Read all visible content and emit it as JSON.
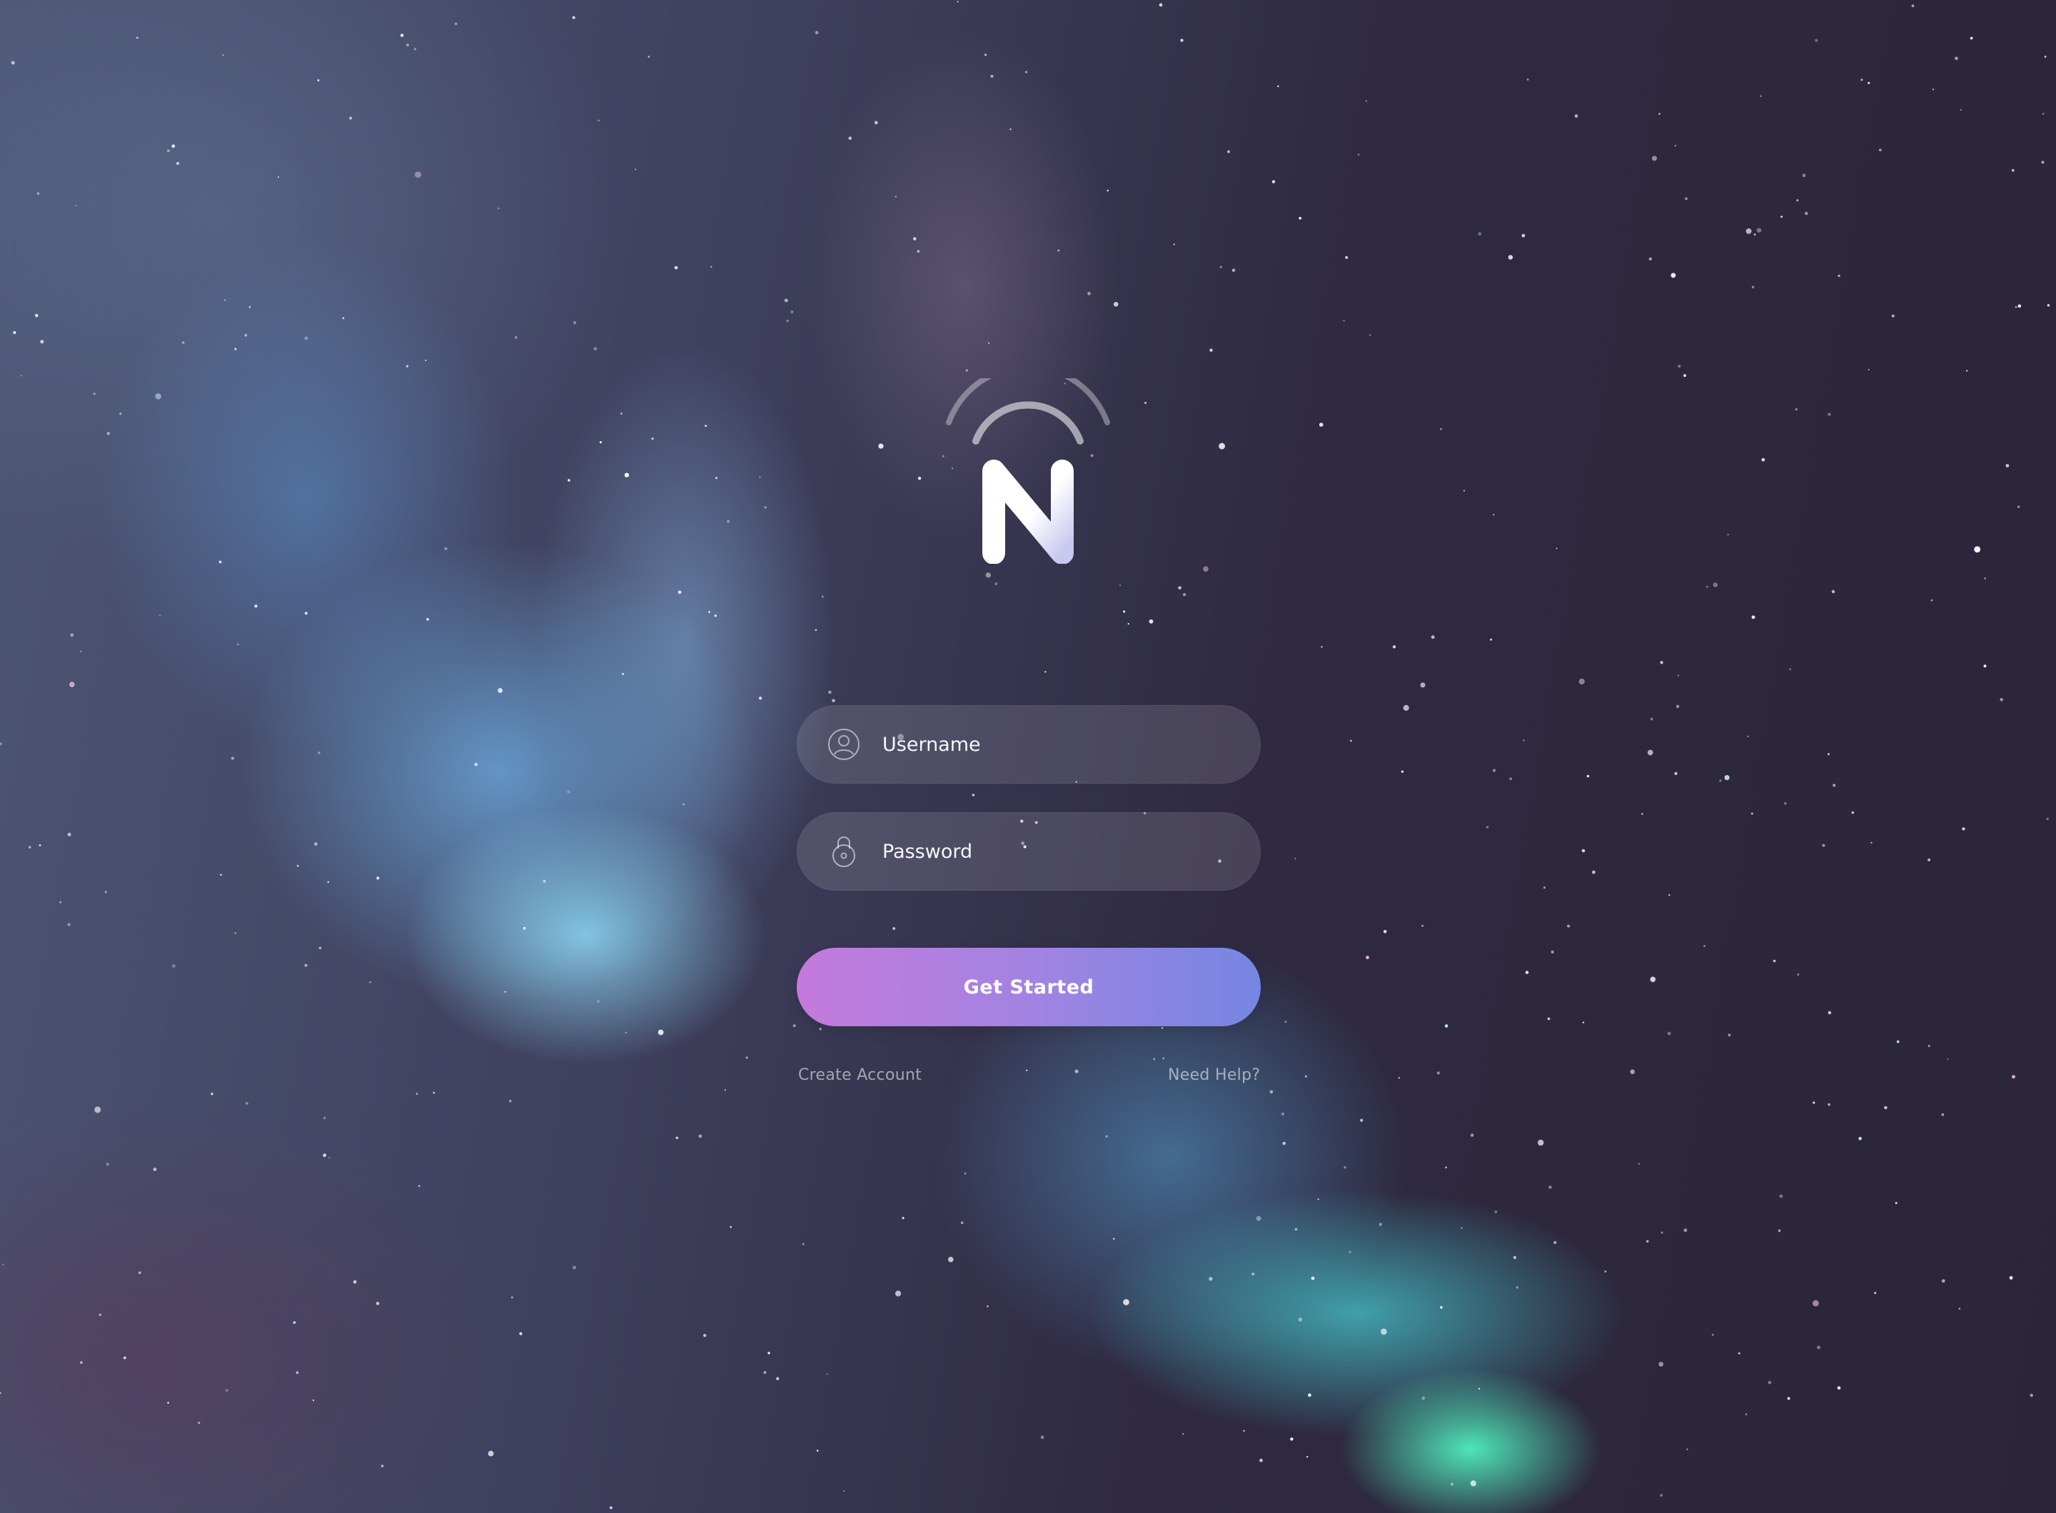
{
  "app": {
    "brand_glyph": "N",
    "logo_icon": "n-signal-logo"
  },
  "form": {
    "username": {
      "placeholder": "Username",
      "value": "",
      "icon": "user-icon"
    },
    "password": {
      "placeholder": "Password",
      "value": "",
      "icon": "lock-icon"
    },
    "submit_label": "Get Started"
  },
  "links": {
    "create_account": "Create Account",
    "need_help": "Need Help?"
  },
  "colors": {
    "button_gradient_start": "#c47adc",
    "button_gradient_end": "#7586e2",
    "field_background": "rgba(255,255,255,0.12)",
    "background_dark": "#2e2840",
    "aurora_teal": "#50f0be",
    "aurora_blue": "#8cd7f5"
  }
}
